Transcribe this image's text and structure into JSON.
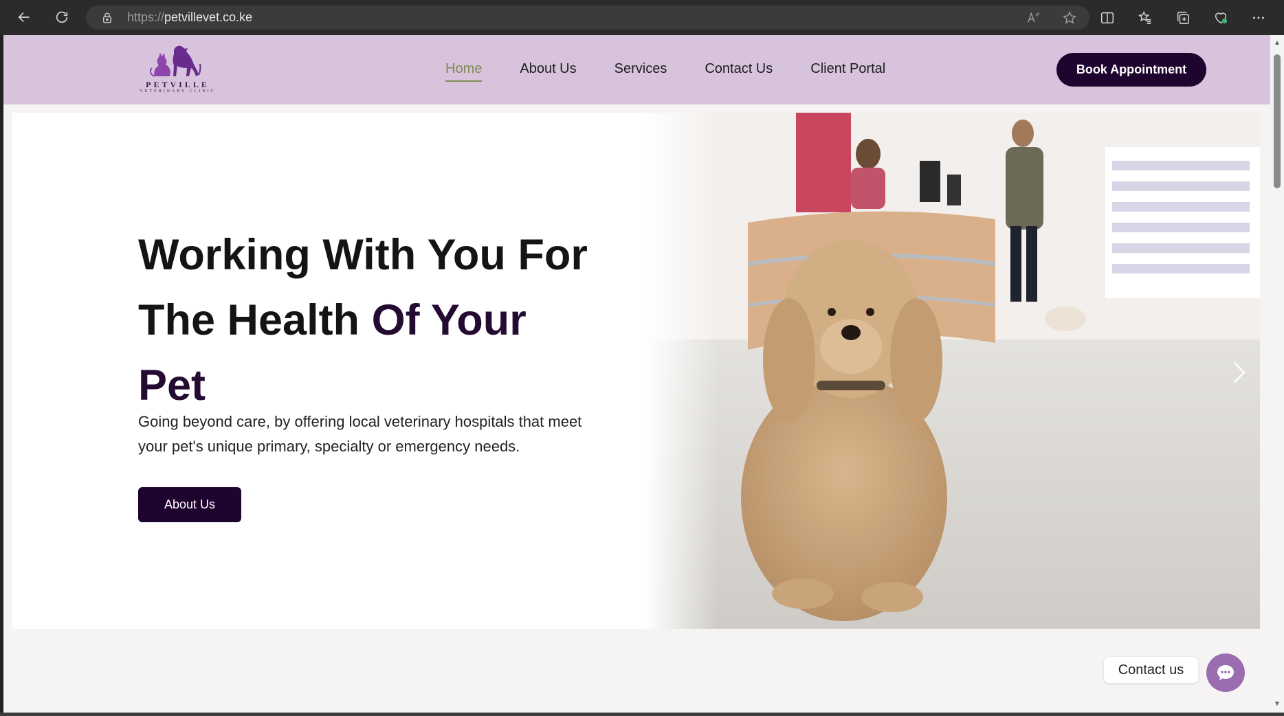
{
  "browser": {
    "url_protocol": "https://",
    "url_host": "petvillevet.co.ke"
  },
  "header": {
    "logo_text": "PETVILLE",
    "logo_subtext": "VETERINARY CLINIC",
    "nav": [
      {
        "label": "Home",
        "active": true
      },
      {
        "label": "About Us",
        "active": false
      },
      {
        "label": "Services",
        "active": false
      },
      {
        "label": "Contact Us",
        "active": false
      },
      {
        "label": "Client Portal",
        "active": false
      }
    ],
    "book_button": "Book Appointment"
  },
  "hero": {
    "title_line1": "Working With You For",
    "title_line2_plain": "The Health ",
    "title_line2_accent": "Of Your",
    "title_line3_accent": "Pet",
    "description": "Going beyond care, by offering local veterinary hospitals that meet your pet's unique primary, specialty or emergency needs.",
    "cta_button": "About Us"
  },
  "contact_widget": {
    "label": "Contact us"
  },
  "colors": {
    "header_bg": "#d8c3dc",
    "brand_dark": "#1e0530",
    "accent_purple": "#230b32",
    "active_nav": "#7e8a57",
    "widget_purple": "#9b6cb0"
  }
}
